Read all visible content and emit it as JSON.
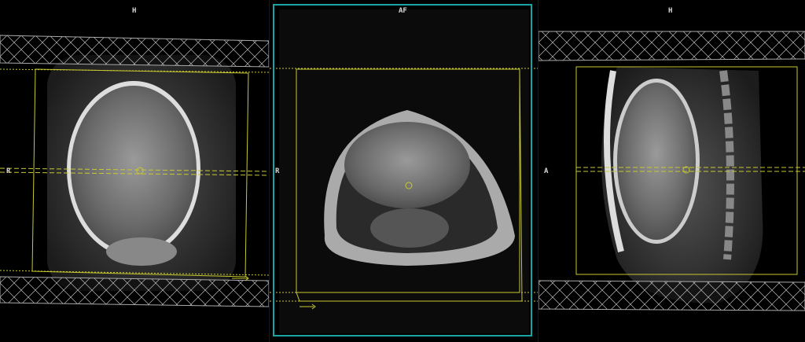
{
  "viewports": [
    {
      "name": "coronal",
      "top_label": "H",
      "side_label": "R",
      "active": false
    },
    {
      "name": "axial",
      "top_label": "AF",
      "side_label": "R",
      "active": true
    },
    {
      "name": "sagittal",
      "top_label": "H",
      "side_label": "A",
      "active": false
    }
  ],
  "colors": {
    "plan_box": "#c8c832",
    "active_border": "#1aa3a3",
    "saturation_band": "#cfcfcf"
  }
}
